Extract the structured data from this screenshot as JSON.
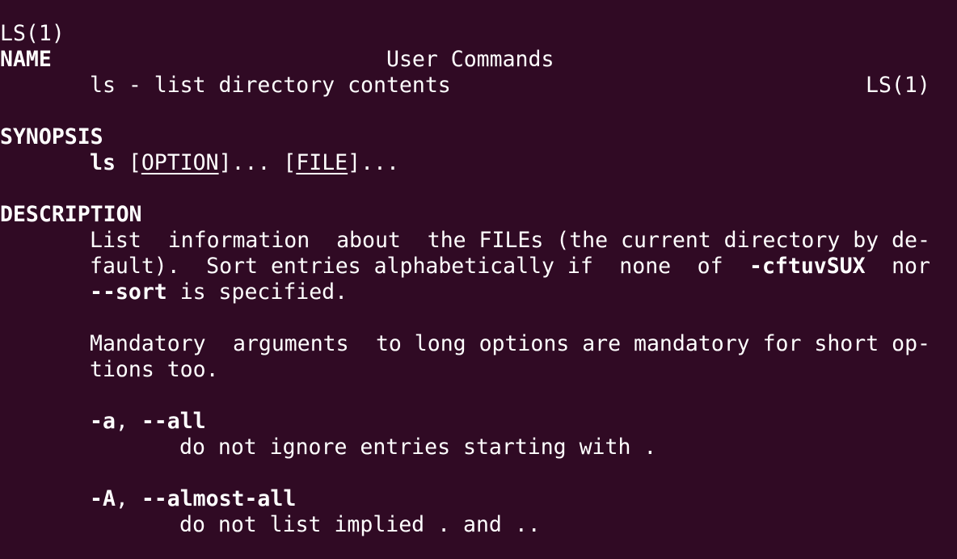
{
  "header": {
    "left": "LS(1)",
    "center": "User Commands",
    "right": "LS(1)"
  },
  "name_section": {
    "heading": "NAME",
    "text": "ls - list directory contents"
  },
  "synopsis_section": {
    "heading": "SYNOPSIS",
    "command": "ls",
    "open1": " [",
    "arg1": "OPTION",
    "close1": "]... [",
    "arg2": "FILE",
    "close2": "]..."
  },
  "description_section": {
    "heading": "DESCRIPTION",
    "p1_line1_words": [
      "List",
      "information",
      "about",
      "the FILEs (the current directory by de-"
    ],
    "p1_line2_words": [
      "fault).",
      "Sort entries alphabetically if",
      "none",
      "of",
      "-cftuvSUX",
      "nor"
    ],
    "p1_line3_bold": "--sort",
    "p1_line3_rest": " is specified.",
    "p2_line1_words": [
      "Mandatory",
      "arguments",
      "to long options are mandatory for short op-"
    ],
    "p2_line2": "tions too."
  },
  "options": [
    {
      "short": "-a",
      "sep": ", ",
      "long": "--all",
      "desc": "do not ignore entries starting with ."
    },
    {
      "short": "-A",
      "sep": ", ",
      "long": "--almost-all",
      "desc": "do not list implied . and .."
    }
  ],
  "colors": {
    "background": "#300a24",
    "foreground": "#ffffff"
  }
}
